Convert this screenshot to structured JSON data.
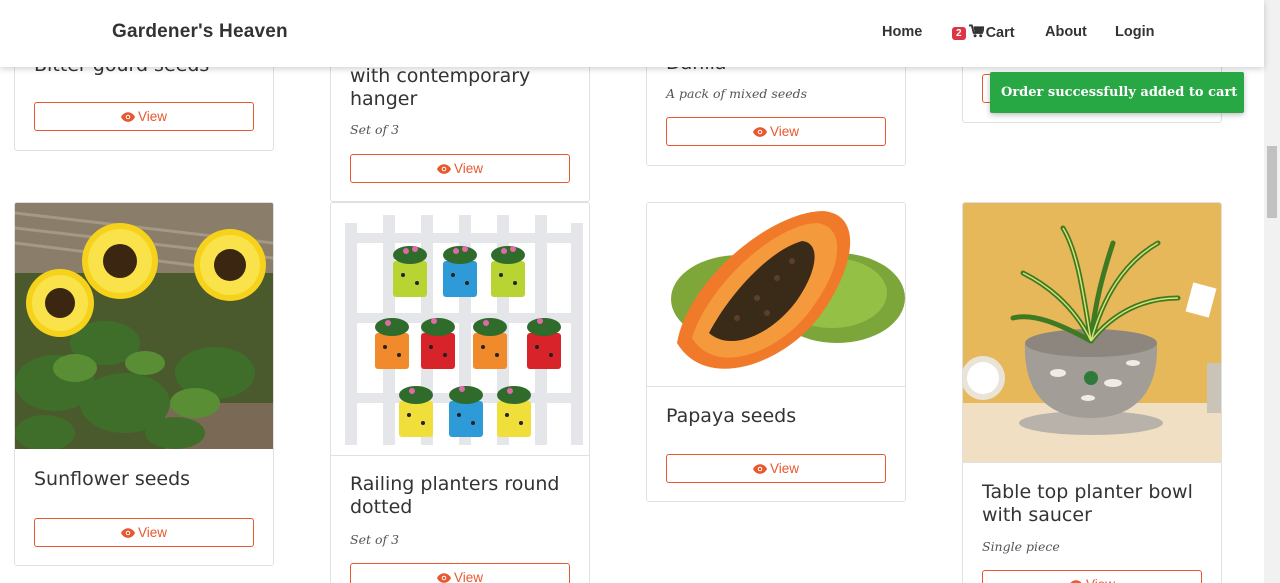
{
  "navbar": {
    "brand": "Gardener's Heaven",
    "links": {
      "home": "Home",
      "cart": "Cart",
      "about": "About",
      "login": "Login"
    },
    "cart_count": "2"
  },
  "toast": {
    "message": "Order successfully added to cart",
    "color": "#28a745"
  },
  "view_label": "View",
  "products_top": [
    {
      "title": "Bitter gourd seeds"
    },
    {
      "title": "with contemporary hanger",
      "subtitle": "Set of 3"
    },
    {
      "title": "Dahlia",
      "subtitle": "A pack of mixed seeds"
    },
    {
      "title": ""
    }
  ],
  "products": [
    {
      "title": "Sunflower seeds",
      "subtitle": "",
      "image": "sunflowers"
    },
    {
      "title": "Railing planters round dotted",
      "subtitle": "Set of 3",
      "image": "railing-planters"
    },
    {
      "title": "Papaya seeds",
      "subtitle": "",
      "image": "papaya"
    },
    {
      "title": "Table top planter bowl with saucer",
      "subtitle": "Single piece",
      "image": "planter-bowl"
    }
  ],
  "colors": {
    "accent": "#e8582f",
    "badge": "#dc3545"
  }
}
